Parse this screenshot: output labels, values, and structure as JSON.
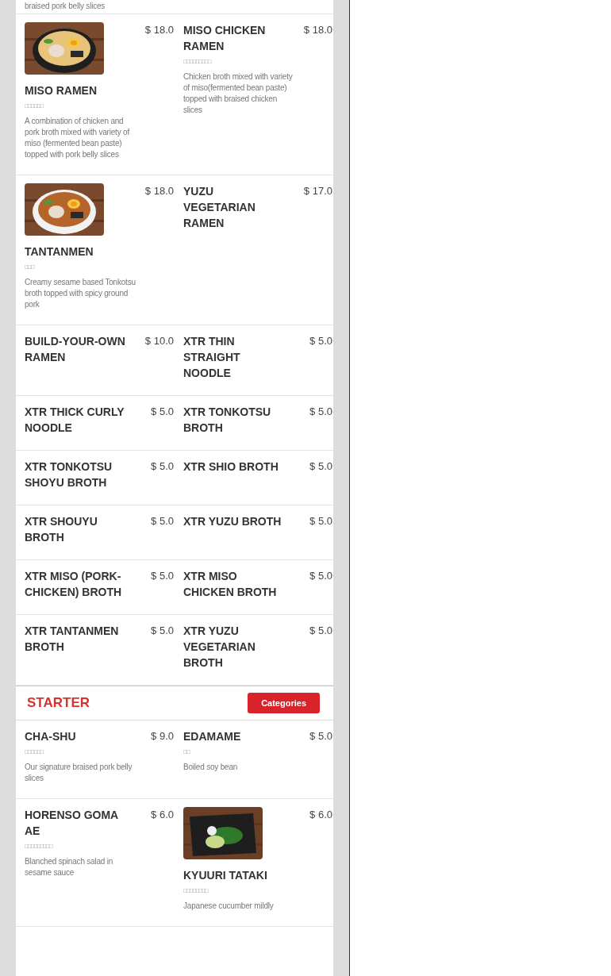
{
  "partial_description": "braised pork belly slices",
  "items": [
    {
      "name": "MISO RAMEN",
      "price": "$ 18.0",
      "subtitle": "□□□□□□",
      "description": "A combination of chicken and pork broth mixed with variety of miso (fermented bean paste) topped with pork belly slices"
    },
    {
      "name": "MISO CHICKEN RAMEN",
      "price": "$ 18.0",
      "subtitle": "□□□□□□□□□",
      "description": "Chicken broth mixed with variety of miso(fermented bean paste) topped with braised chicken slices"
    },
    {
      "name": "TANTANMEN",
      "price": "$ 18.0",
      "subtitle": "□□□",
      "description": "Creamy sesame based Tonkotsu broth topped with spicy ground pork"
    },
    {
      "name": "YUZU VEGETARIAN RAMEN",
      "price": "$ 17.0"
    },
    {
      "name": "BUILD-YOUR-OWN RAMEN",
      "price": "$ 10.0"
    },
    {
      "name": "XTR THIN STRAIGHT NOODLE",
      "price": "$ 5.0"
    },
    {
      "name": "XTR THICK CURLY NOODLE",
      "price": "$ 5.0"
    },
    {
      "name": "XTR TONKOTSU BROTH",
      "price": "$ 5.0"
    },
    {
      "name": "XTR TONKOTSU SHOYU BROTH",
      "price": "$ 5.0"
    },
    {
      "name": "XTR SHIO BROTH",
      "price": "$ 5.0"
    },
    {
      "name": "XTR SHOUYU BROTH",
      "price": "$ 5.0"
    },
    {
      "name": "XTR YUZU BROTH",
      "price": "$ 5.0"
    },
    {
      "name": "XTR MISO (PORK-CHICKEN) BROTH",
      "price": "$ 5.0"
    },
    {
      "name": "XTR MISO CHICKEN BROTH",
      "price": "$ 5.0"
    },
    {
      "name": "XTR TANTANMEN BROTH",
      "price": "$ 5.0"
    },
    {
      "name": "XTR YUZU VEGETARIAN BROTH",
      "price": "$ 5.0"
    }
  ],
  "starter": {
    "title": "STARTER",
    "button": "Categories",
    "items": [
      {
        "name": "CHA-SHU",
        "price": "$ 9.0",
        "subtitle": "□□□□□□",
        "description": "Our signature braised pork belly slices"
      },
      {
        "name": "EDAMAME",
        "price": "$ 5.0",
        "subtitle": "□□",
        "description": "Boiled soy bean"
      },
      {
        "name": "HORENSO GOMA AE",
        "price": "$ 6.0",
        "subtitle": "□□□□□□□□□",
        "description": "Blanched spinach salad in sesame sauce"
      },
      {
        "name": "KYUURI TATAKI",
        "price": "$ 6.0",
        "subtitle": "□□□□□□□□",
        "description": "Japanese cucumber mildly"
      }
    ]
  }
}
